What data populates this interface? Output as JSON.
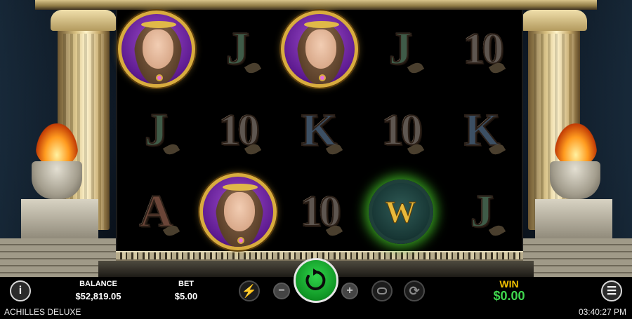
{
  "game": {
    "name": "ACHILLES DELUXE",
    "time": "03:40:27 PM"
  },
  "reels": [
    [
      "portrait",
      "J",
      "A"
    ],
    [
      "J",
      "10",
      "portrait"
    ],
    [
      "portrait",
      "K",
      "10"
    ],
    [
      "J",
      "10",
      "wild"
    ],
    [
      "10",
      "K",
      "J"
    ]
  ],
  "symbols": {
    "wild_letter": "W"
  },
  "hud": {
    "balance_label": "BALANCE",
    "balance_value": "$52,819.05",
    "bet_label": "BET",
    "bet_value": "$5.00",
    "win_label": "WIN",
    "win_value": "$0.00",
    "info_icon_glyph": "i",
    "menu_icon_glyph": "☰",
    "minus_glyph": "−",
    "plus_glyph": "+",
    "turbo_glyph": "⚡",
    "autoplay_glyph": "⟳"
  },
  "colors": {
    "spin_green": "#1fb536",
    "win_label": "#f2c200",
    "win_value": "#3fd84e",
    "portrait_frame": "#d8ac3e",
    "wild_glow": "#46c828"
  }
}
